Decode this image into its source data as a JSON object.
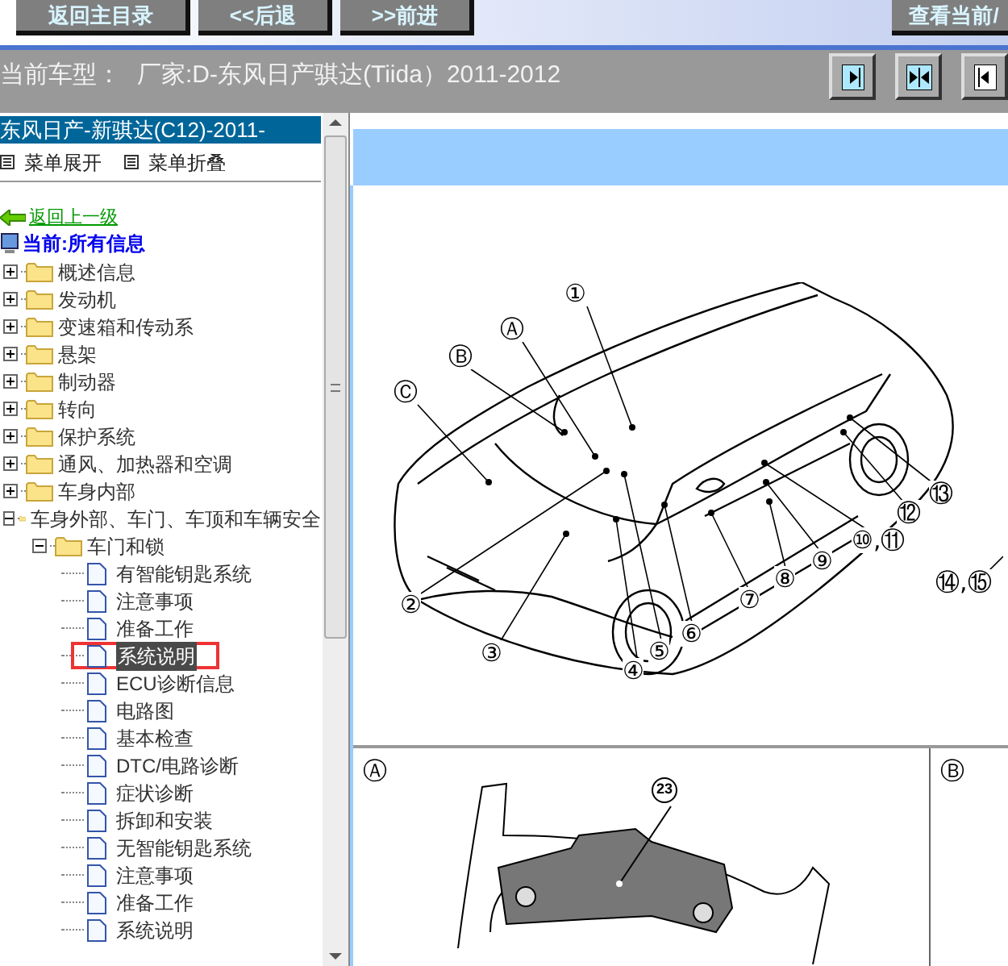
{
  "toolbar": {
    "buttons": [
      {
        "label": "返回主目录"
      },
      {
        "label": "<<后退"
      },
      {
        "label": ">>前进"
      },
      {
        "label": "查看当前/"
      }
    ]
  },
  "model_bar": {
    "label": "当前车型：",
    "value": "厂家:D-东风日产骐达(Tiida）2011-2012"
  },
  "sidebar": {
    "title": "东风日产-新骐达(C12)-2011-",
    "actions": [
      "菜单展开",
      "菜单折叠"
    ],
    "back_link": "返回上一级",
    "current": "当前:所有信息",
    "tree": [
      {
        "kind": "folder",
        "label": "概述信息",
        "expanded": false
      },
      {
        "kind": "folder",
        "label": "发动机",
        "expanded": false
      },
      {
        "kind": "folder",
        "label": "变速箱和传动系",
        "expanded": false
      },
      {
        "kind": "folder",
        "label": "悬架",
        "expanded": false
      },
      {
        "kind": "folder",
        "label": "制动器",
        "expanded": false
      },
      {
        "kind": "folder",
        "label": "转向",
        "expanded": false
      },
      {
        "kind": "folder",
        "label": "保护系统",
        "expanded": false
      },
      {
        "kind": "folder",
        "label": "通风、加热器和空调",
        "expanded": false
      },
      {
        "kind": "folder",
        "label": "车身内部",
        "expanded": false
      },
      {
        "kind": "folder",
        "label": "车身外部、车门、车顶和车辆安全",
        "expanded": true,
        "children": [
          {
            "kind": "folder",
            "label": "车门和锁",
            "expanded": true,
            "children": [
              {
                "kind": "doc",
                "label": "有智能钥匙系统",
                "selected": false
              },
              {
                "kind": "doc",
                "label": "注意事项",
                "selected": false
              },
              {
                "kind": "doc",
                "label": "准备工作",
                "selected": false
              },
              {
                "kind": "doc",
                "label": "系统说明",
                "selected": true
              },
              {
                "kind": "doc",
                "label": "ECU诊断信息",
                "selected": false
              },
              {
                "kind": "doc",
                "label": "电路图",
                "selected": false
              },
              {
                "kind": "doc",
                "label": "基本检查",
                "selected": false
              },
              {
                "kind": "doc",
                "label": "DTC/电路诊断",
                "selected": false
              },
              {
                "kind": "doc",
                "label": "症状诊断",
                "selected": false
              },
              {
                "kind": "doc",
                "label": "拆卸和安装",
                "selected": false
              },
              {
                "kind": "doc",
                "label": "无智能钥匙系统",
                "selected": false
              },
              {
                "kind": "doc",
                "label": "注意事项",
                "selected": false
              },
              {
                "kind": "doc",
                "label": "准备工作",
                "selected": false
              },
              {
                "kind": "doc",
                "label": "系统说明",
                "selected": false
              }
            ]
          }
        ]
      }
    ]
  },
  "document": {
    "callouts": [
      {
        "kind": "glyph",
        "text": "①"
      },
      {
        "kind": "glyph",
        "text": "Ⓐ"
      },
      {
        "kind": "glyph",
        "text": "Ⓑ"
      },
      {
        "kind": "glyph",
        "text": "Ⓒ"
      },
      {
        "kind": "glyph",
        "text": "②"
      },
      {
        "kind": "glyph",
        "text": "③"
      },
      {
        "kind": "glyph",
        "text": "④"
      },
      {
        "kind": "glyph",
        "text": "⑤"
      },
      {
        "kind": "glyph",
        "text": "⑥"
      },
      {
        "kind": "glyph",
        "text": "⑦"
      },
      {
        "kind": "glyph",
        "text": "⑧"
      },
      {
        "kind": "glyph",
        "text": "⑨"
      },
      {
        "kind": "glyph",
        "text": "⑩,⑪"
      },
      {
        "kind": "glyph",
        "text": "⑫"
      },
      {
        "kind": "glyph",
        "text": "⑬"
      },
      {
        "kind": "glyph",
        "text": "⑭,⑮"
      }
    ],
    "detail_panels": [
      {
        "label": "Ⓐ",
        "callout": "23"
      },
      {
        "label": "Ⓑ"
      }
    ]
  }
}
